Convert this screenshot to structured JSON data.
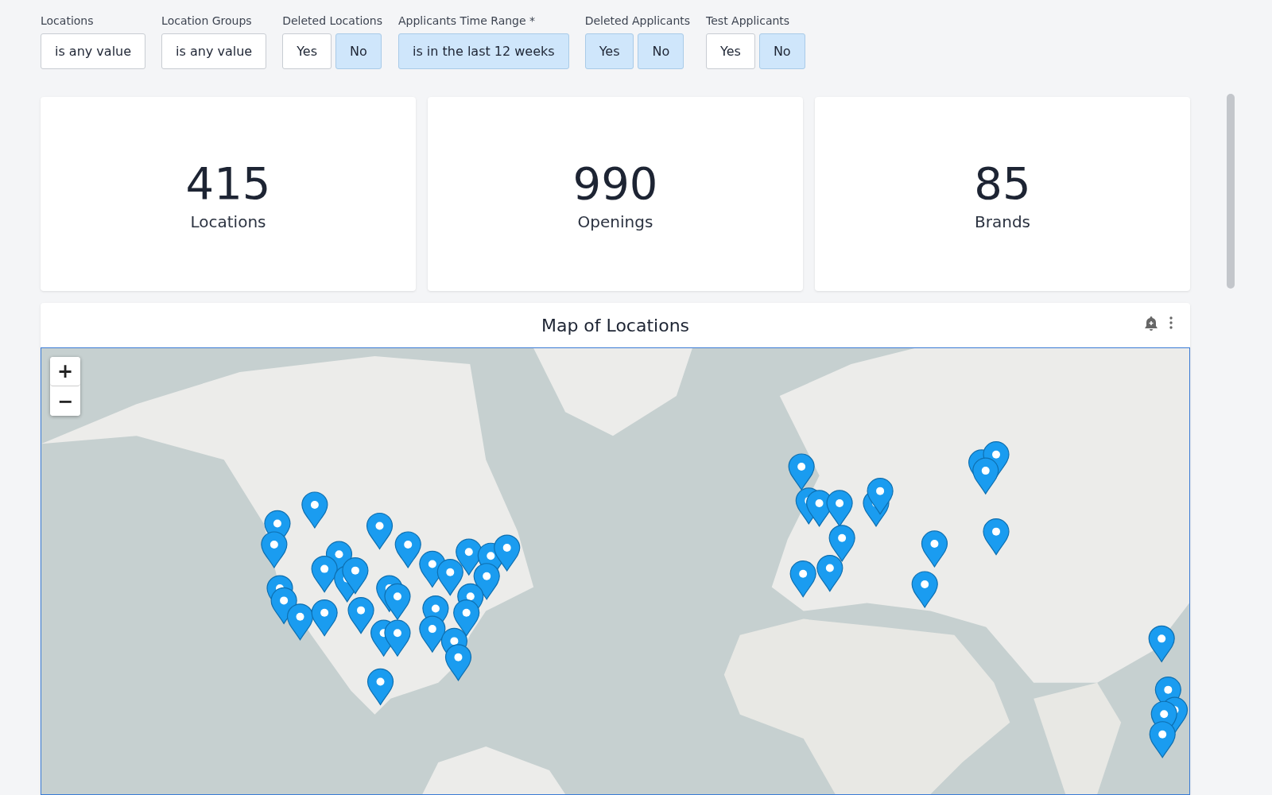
{
  "filters": [
    {
      "label": "Locations",
      "kind": "dropdown",
      "value": "is any value"
    },
    {
      "label": "Location Groups",
      "kind": "dropdown",
      "value": "is any value"
    },
    {
      "label": "Deleted Locations",
      "kind": "toggle",
      "options": [
        {
          "label": "Yes",
          "selected": false
        },
        {
          "label": "No",
          "selected": true
        }
      ]
    },
    {
      "label": "Applicants Time Range *",
      "kind": "dropdown",
      "value": "is in the last 12 weeks",
      "selected": true
    },
    {
      "label": "Deleted Applicants",
      "kind": "toggle",
      "options": [
        {
          "label": "Yes",
          "selected": true
        },
        {
          "label": "No",
          "selected": true
        }
      ]
    },
    {
      "label": "Test Applicants",
      "kind": "toggle",
      "options": [
        {
          "label": "Yes",
          "selected": false
        },
        {
          "label": "No",
          "selected": true
        }
      ]
    }
  ],
  "metrics": [
    {
      "value": "415",
      "label": "Locations"
    },
    {
      "value": "990",
      "label": "Openings"
    },
    {
      "value": "85",
      "label": "Brands"
    }
  ],
  "map": {
    "title": "Map of Locations",
    "zoom_controls": [
      "+",
      "−"
    ],
    "kind": "picture"
  }
}
